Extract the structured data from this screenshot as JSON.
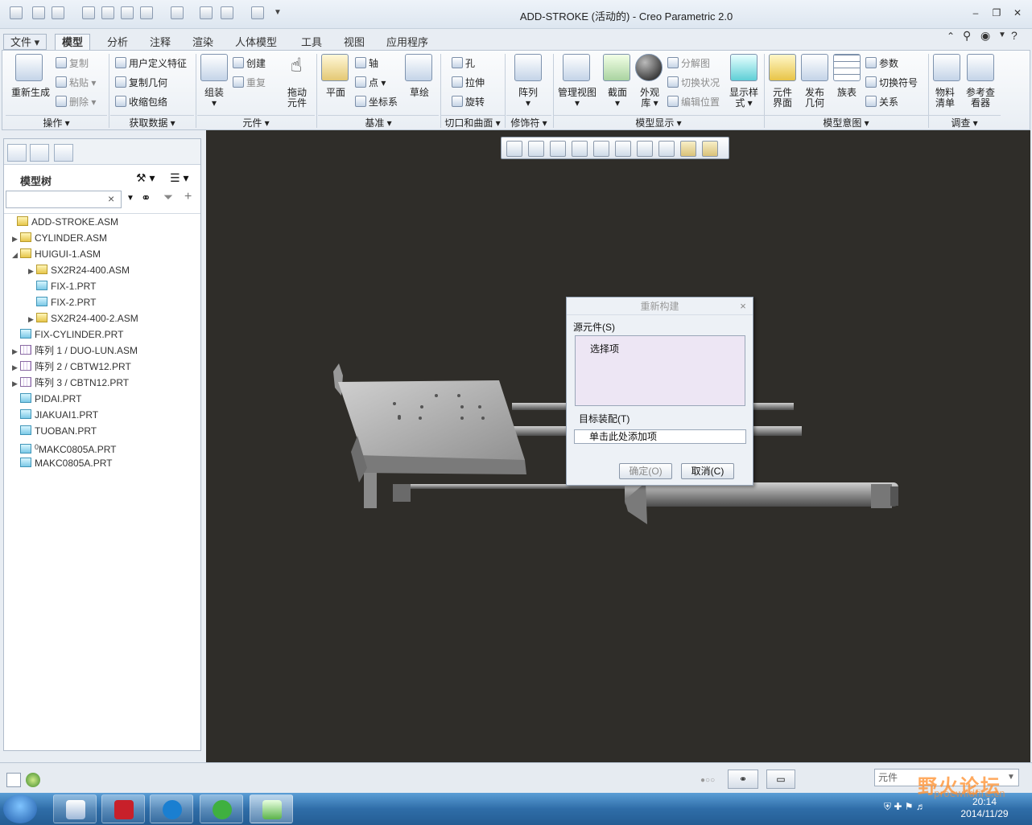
{
  "window": {
    "title": "ADD-STROKE (活动的) - Creo Parametric 2.0"
  },
  "tabs": [
    "文件",
    "模型",
    "分析",
    "注释",
    "渲染",
    "人体模型",
    "工具",
    "视图",
    "应用程序"
  ],
  "ribbon": {
    "operations": {
      "regenerate": "重新生成",
      "copy": "复制",
      "paste": "粘贴",
      "delete": "删除",
      "group": "操作"
    },
    "get_data": {
      "udf": "用户定义特征",
      "copy_geom": "复制几何",
      "shrinkwrap": "收缩包络",
      "group": "获取数据"
    },
    "component": {
      "assemble": "组装",
      "create": "创建",
      "repeat": "重复",
      "drag_line1": "拖动",
      "drag_line2": "元件",
      "group": "元件"
    },
    "datum": {
      "plane": "平面",
      "axis": "轴",
      "point": "点",
      "csys": "坐标系",
      "sketch": "草绘",
      "group": "基准"
    },
    "cut_surface": {
      "hole": "孔",
      "extrude": "拉伸",
      "revolve": "旋转",
      "group": "切口和曲面"
    },
    "modifiers": {
      "pattern": "阵列",
      "group": "修饰符"
    },
    "model_display": {
      "manage_views": "管理视图",
      "section": "截面",
      "appearance_line1": "外观",
      "appearance_line2": "库",
      "exploded": "分解图",
      "toggle_status": "切换状况",
      "edit_position": "编辑位置",
      "display_style_line1": "显示样",
      "display_style_line2": "式",
      "group": "模型显示"
    },
    "model_intent": {
      "component_interface_line1": "元件",
      "component_interface_line2": "界面",
      "publish_geom_line1": "发布",
      "publish_geom_line2": "几何",
      "family_table": "族表",
      "parameters": "参数",
      "switch_symbol": "切换符号",
      "relations": "关系",
      "group": "模型意图"
    },
    "investigate": {
      "bom_line1": "物料",
      "bom_line2": "清单",
      "ref_viewer_line1": "参考查",
      "ref_viewer_line2": "看器",
      "group": "调查"
    }
  },
  "model_tree": {
    "header": "模型树",
    "search_clear": "×",
    "items": [
      {
        "label": "ADD-STROKE.ASM",
        "type": "asm",
        "expander": ""
      },
      {
        "label": "CYLINDER.ASM",
        "type": "asm",
        "expander": "▶"
      },
      {
        "label": "HUIGUI-1.ASM",
        "type": "asm",
        "expander": "◢"
      },
      {
        "label": "SX2R24-400.ASM",
        "type": "asm",
        "expander": "▶"
      },
      {
        "label": "FIX-1.PRT",
        "type": "prt",
        "expander": ""
      },
      {
        "label": "FIX-2.PRT",
        "type": "prt",
        "expander": ""
      },
      {
        "label": "SX2R24-400-2.ASM",
        "type": "asm",
        "expander": "▶"
      },
      {
        "label": "FIX-CYLINDER.PRT",
        "type": "prt",
        "expander": ""
      },
      {
        "label": "阵列 1 / DUO-LUN.ASM",
        "type": "pat",
        "expander": "▶"
      },
      {
        "label": "阵列 2 / CBTW12.PRT",
        "type": "pat",
        "expander": "▶"
      },
      {
        "label": "阵列 3 / CBTN12.PRT",
        "type": "pat",
        "expander": "▶"
      },
      {
        "label": "PIDAI.PRT",
        "type": "prt",
        "expander": ""
      },
      {
        "label": "JIAKUAI1.PRT",
        "type": "prt",
        "expander": ""
      },
      {
        "label": "TUOBAN.PRT",
        "type": "prt",
        "expander": ""
      },
      {
        "label": "MAKC0805A.PRT",
        "type": "prt",
        "expander": "",
        "marker": "0"
      },
      {
        "label": "MAKC0805A.PRT",
        "type": "prt",
        "expander": ""
      }
    ]
  },
  "dialog": {
    "title": "重新构建",
    "close": "×",
    "source_label": "源元件(S)",
    "source_item": "选择项",
    "target_label": "目标装配(T)",
    "target_placeholder": "单击此处添加项",
    "ok": "确定(O)",
    "cancel": "取消(C)"
  },
  "status": {
    "filter_value": "元件"
  },
  "taskbar": {
    "time": "20:14",
    "date": "2014/11/29"
  },
  "watermark": {
    "text": "野火论坛",
    "url": "proewildfire.cn"
  },
  "colors": {
    "viewport_bg": "#2f2d29",
    "ribbon_bg": "#eef2f7",
    "taskbar": "#2f6da8"
  }
}
